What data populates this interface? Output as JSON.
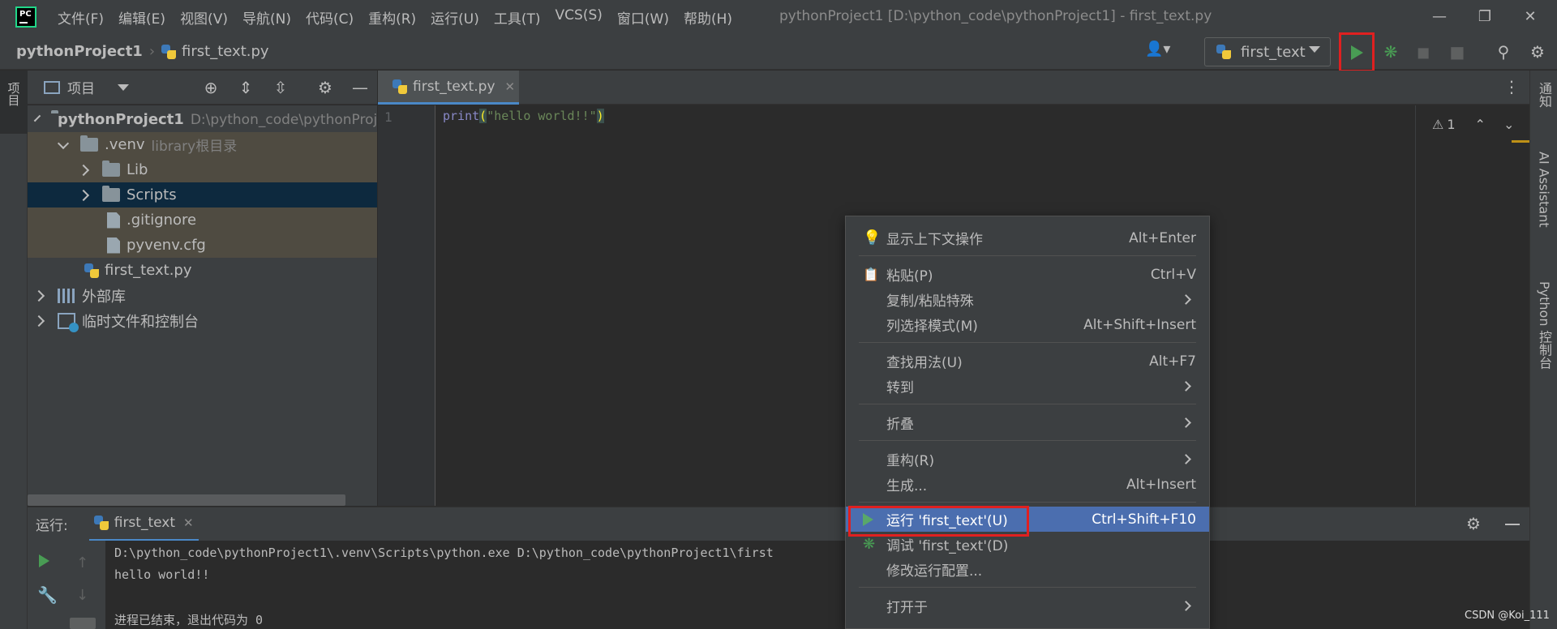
{
  "menu": [
    "文件(F)",
    "编辑(E)",
    "视图(V)",
    "导航(N)",
    "代码(C)",
    "重构(R)",
    "运行(U)",
    "工具(T)",
    "VCS(S)",
    "窗口(W)",
    "帮助(H)"
  ],
  "window_title": "pythonProject1 [D:\\python_code\\pythonProject1] - first_text.py",
  "breadcrumb": {
    "project": "pythonProject1",
    "file": "first_text.py"
  },
  "run_config": {
    "name": "first_text"
  },
  "left_strip": {
    "project_tab": "项目"
  },
  "right_strip": {
    "notifications": "通知",
    "ai_assistant": "AI Assistant",
    "python_console": "Python 控制台"
  },
  "project_panel": {
    "title": "项目",
    "tree": {
      "root_name": "pythonProject1",
      "root_path": "D:\\python_code\\pythonProj",
      "venv_name": ".venv",
      "venv_hint": "library根目录",
      "lib": "Lib",
      "scripts": "Scripts",
      "gitignore": ".gitignore",
      "pyvenv": "pyvenv.cfg",
      "first_text": "first_text.py",
      "external_libs": "外部库",
      "scratches": "临时文件和控制台"
    }
  },
  "editor": {
    "tab_label": "first_text.py",
    "line_number": "1",
    "code": {
      "fn": "print",
      "open": "(",
      "string": "\"hello world!!\"",
      "close": ")"
    },
    "warnings_count": "1"
  },
  "run_panel": {
    "label": "运行:",
    "tab_label": "first_text",
    "console": [
      "D:\\python_code\\pythonProject1\\.venv\\Scripts\\python.exe D:\\python_code\\pythonProject1\\first",
      "hello world!!",
      "",
      "进程已结束，退出代码为 0"
    ]
  },
  "context_menu": {
    "show_context_actions": {
      "label": "显示上下文操作",
      "shortcut": "Alt+Enter"
    },
    "paste": {
      "label": "粘贴(P)",
      "shortcut": "Ctrl+V"
    },
    "copy_paste_special": {
      "label": "复制/粘贴特殊"
    },
    "column_selection": {
      "label": "列选择模式(M)",
      "shortcut": "Alt+Shift+Insert"
    },
    "find_usages": {
      "label": "查找用法(U)",
      "shortcut": "Alt+F7"
    },
    "goto": {
      "label": "转到"
    },
    "folding": {
      "label": "折叠"
    },
    "refactor": {
      "label": "重构(R)"
    },
    "generate": {
      "label": "生成...",
      "shortcut": "Alt+Insert"
    },
    "run": {
      "label": "运行 'first_text'(U)",
      "shortcut": "Ctrl+Shift+F10"
    },
    "debug": {
      "label": "调试 'first_text'(D)"
    },
    "modify_run_config": {
      "label": "修改运行配置..."
    },
    "open_in": {
      "label": "打开于"
    }
  },
  "watermark": "CSDN @Koi_111",
  "colors": {
    "run_green": "#499c54",
    "highlight": "#4b6eaf",
    "annotation_red": "#e02020"
  }
}
